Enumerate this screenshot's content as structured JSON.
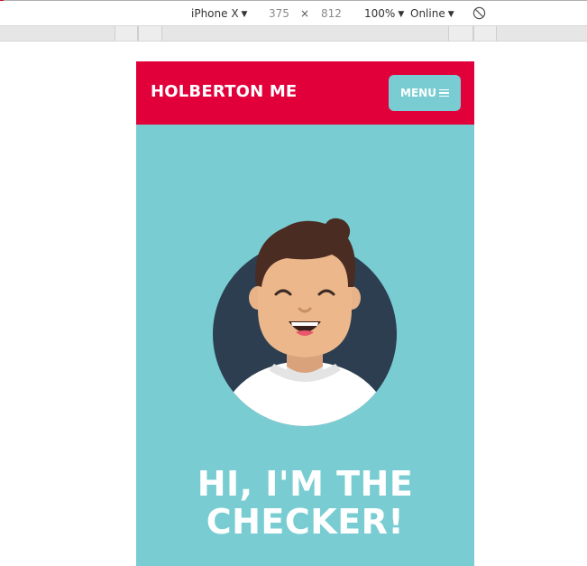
{
  "devtools": {
    "device": "iPhone X",
    "width": "375",
    "height": "812",
    "zoom": "100%",
    "network": "Online",
    "times": "×"
  },
  "page": {
    "brand": "HOLBERTON ME",
    "menu_label": "MENU",
    "headline_line1": "HI, I'M THE",
    "headline_line2": "CHECKER!"
  },
  "colors": {
    "header": "#e2003b",
    "hero": "#79cdd2",
    "button": "#79cdd2"
  }
}
